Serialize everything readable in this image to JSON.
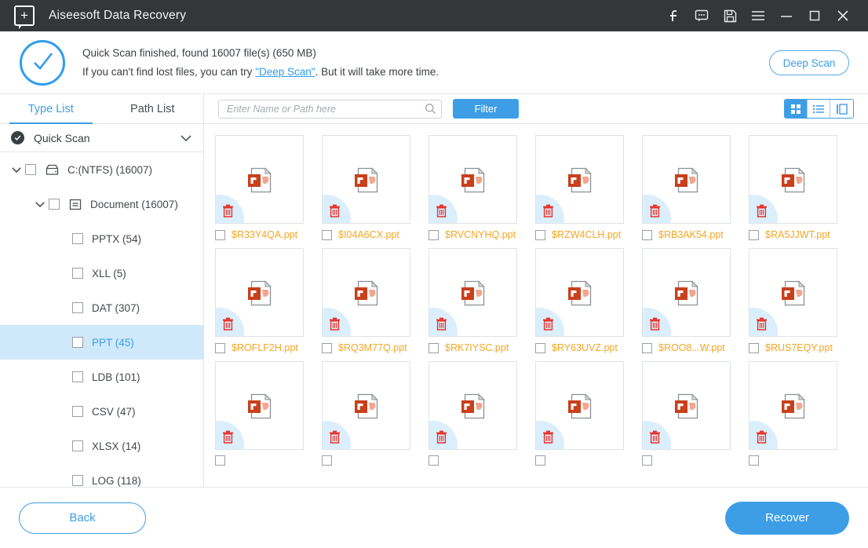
{
  "titlebar": {
    "app_title": "Aiseesoft Data Recovery",
    "logo_icon": "add-box-icon",
    "icons": [
      {
        "name": "facebook-icon",
        "glyph": "f"
      },
      {
        "name": "feedback-chat-icon",
        "glyph": "chat"
      },
      {
        "name": "save-icon",
        "glyph": "floppy"
      },
      {
        "name": "menu-icon",
        "glyph": "hamburger"
      },
      {
        "name": "minimize-icon",
        "glyph": "minus"
      },
      {
        "name": "maximize-icon",
        "glyph": "square"
      },
      {
        "name": "close-icon",
        "glyph": "x"
      }
    ]
  },
  "banner": {
    "status_icon": "check-circle-icon",
    "line1": "Quick Scan finished, found 16007 file(s) (650 MB)",
    "line2_before": "If you can't find lost files, you can try ",
    "line2_link": "\"Deep Scan\"",
    "line2_after": ". But it will take more time.",
    "deep_scan_button": "Deep Scan",
    "accent_color": "#3d9ee6"
  },
  "sidebar": {
    "tabs": [
      {
        "label": "Type List",
        "active": true
      },
      {
        "label": "Path List",
        "active": false
      }
    ],
    "scan_mode": {
      "label": "Quick Scan",
      "badge_icon": "check-badge-icon",
      "chevron": "chevron-down-icon"
    },
    "tree": [
      {
        "label": "C:(NTFS) (16007)",
        "indent": 0,
        "caret": true,
        "checkbox": true,
        "icon": "drive-icon",
        "selected": false
      },
      {
        "label": "Document (16007)",
        "indent": 1,
        "caret": true,
        "checkbox": true,
        "icon": "document-icon",
        "selected": false
      },
      {
        "label": "PPTX (54)",
        "indent": 2,
        "caret": false,
        "checkbox": true,
        "icon": null,
        "selected": false
      },
      {
        "label": "XLL (5)",
        "indent": 2,
        "caret": false,
        "checkbox": true,
        "icon": null,
        "selected": false
      },
      {
        "label": "DAT (307)",
        "indent": 2,
        "caret": false,
        "checkbox": true,
        "icon": null,
        "selected": false
      },
      {
        "label": "PPT (45)",
        "indent": 2,
        "caret": false,
        "checkbox": true,
        "icon": null,
        "selected": true
      },
      {
        "label": "LDB (101)",
        "indent": 2,
        "caret": false,
        "checkbox": true,
        "icon": null,
        "selected": false
      },
      {
        "label": "CSV (47)",
        "indent": 2,
        "caret": false,
        "checkbox": true,
        "icon": null,
        "selected": false
      },
      {
        "label": "XLSX (14)",
        "indent": 2,
        "caret": false,
        "checkbox": true,
        "icon": null,
        "selected": false
      },
      {
        "label": "LOG (118)",
        "indent": 2,
        "caret": false,
        "checkbox": true,
        "icon": null,
        "selected": false
      }
    ]
  },
  "toolbar": {
    "search_placeholder": "Enter Name or Path here",
    "search_value": "",
    "search_icon": "search-icon",
    "filter_label": "Filter",
    "views": [
      {
        "name": "grid-view-button",
        "icon": "grid-icon",
        "active": true
      },
      {
        "name": "list-view-button",
        "icon": "list-icon",
        "active": false
      },
      {
        "name": "detail-view-button",
        "icon": "detail-panel-icon",
        "active": false
      }
    ]
  },
  "files": [
    {
      "name": "$R33Y4QA.ppt",
      "icon": "powerpoint-file-icon",
      "deleted": true
    },
    {
      "name": "$I04A6CX.ppt",
      "icon": "powerpoint-file-icon",
      "deleted": true
    },
    {
      "name": "$RVCNYHQ.ppt",
      "icon": "powerpoint-file-icon",
      "deleted": true
    },
    {
      "name": "$RZW4CLH.ppt",
      "icon": "powerpoint-file-icon",
      "deleted": true
    },
    {
      "name": "$RB3AK54.ppt",
      "icon": "powerpoint-file-icon",
      "deleted": true
    },
    {
      "name": "$RA5JJWT.ppt",
      "icon": "powerpoint-file-icon",
      "deleted": true
    },
    {
      "name": "$ROFLF2H.ppt",
      "icon": "powerpoint-file-icon",
      "deleted": true
    },
    {
      "name": "$RQ3M77Q.ppt",
      "icon": "powerpoint-file-icon",
      "deleted": true
    },
    {
      "name": "$RK7IYSC.ppt",
      "icon": "powerpoint-file-icon",
      "deleted": true
    },
    {
      "name": "$RY63UVZ.ppt",
      "icon": "powerpoint-file-icon",
      "deleted": true
    },
    {
      "name": "$ROO8...W.ppt",
      "icon": "powerpoint-file-icon",
      "deleted": true
    },
    {
      "name": "$RUS7EQY.ppt",
      "icon": "powerpoint-file-icon",
      "deleted": true
    },
    {
      "name": "",
      "icon": "powerpoint-file-icon",
      "deleted": true
    },
    {
      "name": "",
      "icon": "powerpoint-file-icon",
      "deleted": true
    },
    {
      "name": "",
      "icon": "powerpoint-file-icon",
      "deleted": true
    },
    {
      "name": "",
      "icon": "powerpoint-file-icon",
      "deleted": true
    },
    {
      "name": "",
      "icon": "powerpoint-file-icon",
      "deleted": true
    },
    {
      "name": "",
      "icon": "powerpoint-file-icon",
      "deleted": true
    }
  ],
  "footer": {
    "back_label": "Back",
    "recover_label": "Recover"
  }
}
